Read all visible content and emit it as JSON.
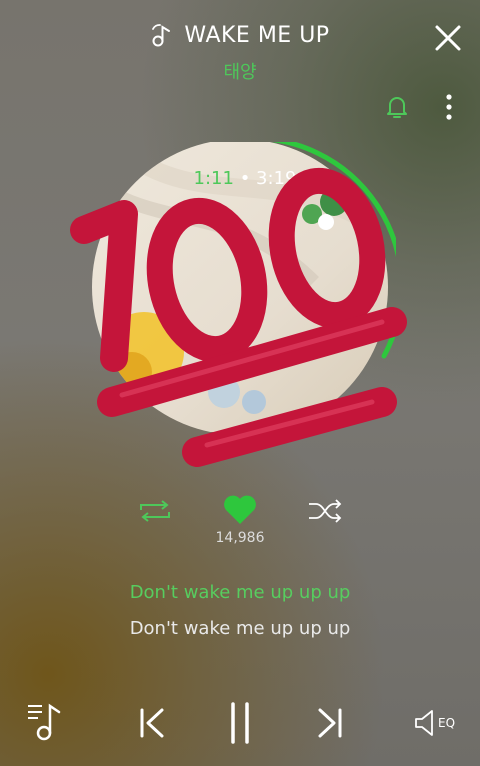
{
  "header": {
    "song_title": "WAKE ME UP",
    "artist": "태양",
    "icons": {
      "title": "music-note-icon",
      "close": "close-icon",
      "bell": "bell-icon",
      "more": "more-vertical-icon"
    }
  },
  "player": {
    "current_time": "1:11",
    "separator": "•",
    "total_time": "3:19",
    "progress": 0.357,
    "overlay_emoji": "hundred-points-emoji",
    "likes": "14,986"
  },
  "lyrics": {
    "current": "Don't wake me up up up",
    "next": "Don't wake me up up up"
  },
  "bottom_bar": {
    "eq_label": "EQ"
  },
  "colors": {
    "accent": "#4ec85a",
    "hundred_red": "#c4153a"
  }
}
